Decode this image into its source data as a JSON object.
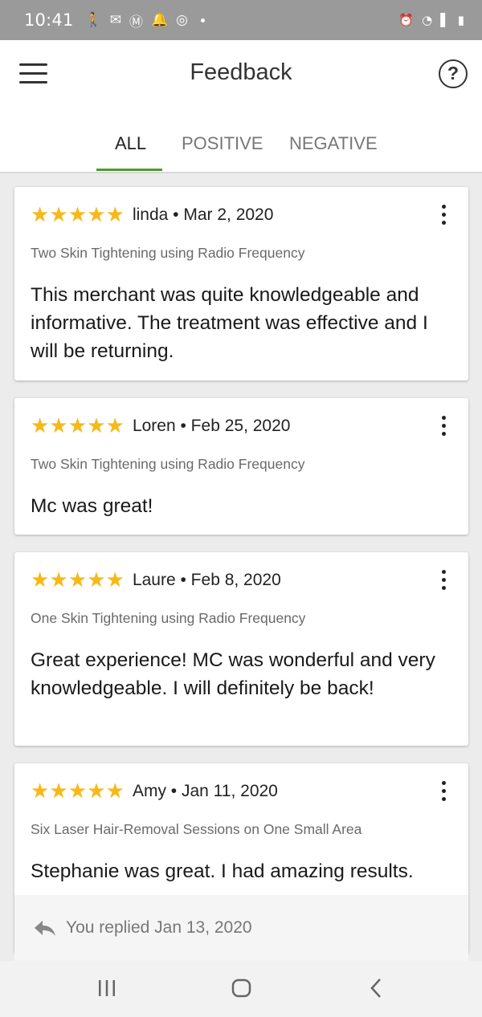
{
  "status_bar": {
    "time": "10:41"
  },
  "header": {
    "title": "Feedback"
  },
  "tabs": [
    {
      "label": "ALL",
      "active": true
    },
    {
      "label": "POSITIVE",
      "active": false
    },
    {
      "label": "NEGATIVE",
      "active": false
    }
  ],
  "reviews": [
    {
      "rating": 5,
      "author": "linda",
      "date": "Mar 2, 2020",
      "meta": "linda • Mar 2, 2020",
      "deal": "Two Skin Tightening using Radio Frequency",
      "text": "This merchant was quite knowledgeable and informative. The treatment was effective and I will be returning."
    },
    {
      "rating": 5,
      "author": "Loren",
      "date": "Feb 25, 2020",
      "meta": "Loren • Feb 25, 2020",
      "deal": "Two Skin Tightening using Radio Frequency",
      "text": "Mc was great!"
    },
    {
      "rating": 5,
      "author": "Laure",
      "date": "Feb 8, 2020",
      "meta": "Laure • Feb 8, 2020",
      "deal": "One Skin Tightening using Radio Frequency",
      "text": "Great experience! MC was wonderful and very knowledgeable. I will definitely be back!"
    },
    {
      "rating": 5,
      "author": "Amy",
      "date": "Jan 11, 2020",
      "meta": "Amy • Jan 11, 2020",
      "deal": "Six Laser Hair-Removal Sessions on One Small Area",
      "text": "Stephanie was great. I had amazing results.",
      "reply": "You replied Jan 13, 2020"
    }
  ],
  "colors": {
    "accent": "#4e9a2f",
    "star": "#f6b918",
    "status_bar": "#9a9a9a"
  },
  "icons": [
    "menu-icon",
    "help-icon",
    "star-icon",
    "more-vert-icon",
    "reply-icon",
    "recent-apps-icon",
    "home-icon",
    "back-icon"
  ]
}
